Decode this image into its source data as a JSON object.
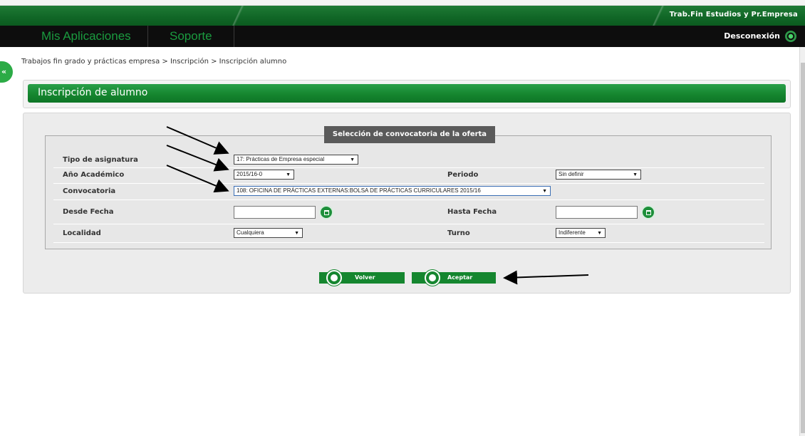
{
  "header": {
    "app_name": "Trab.Fin Estudios y Pr.Empresa",
    "nav": [
      "Mis Aplicaciones",
      "Soporte"
    ],
    "logout_label": "Desconexión"
  },
  "breadcrumb": "Trabajos fin grado y prácticas empresa > Inscripción > Inscripción alumno",
  "page_title": "Inscripción de alumno",
  "form": {
    "legend": "Selección de convocatoria de la oferta",
    "tipo_label": "Tipo de asignatura",
    "tipo_value": "17: Prácticas de Empresa especial",
    "anio_label": "Año Académico",
    "anio_value": "2015/16-0",
    "periodo_label": "Periodo",
    "periodo_value": "Sin definir",
    "convocatoria_label": "Convocatoria",
    "convocatoria_value": "108: OFICINA DE PRÁCTICAS EXTERNAS:BOLSA DE PRÁCTICAS CURRICULARES 2015/16",
    "desde_label": "Desde Fecha",
    "desde_value": "",
    "hasta_label": "Hasta Fecha",
    "hasta_value": "",
    "localidad_label": "Localidad",
    "localidad_value": "Cualquiera",
    "turno_label": "Turno",
    "turno_value": "Indiferente"
  },
  "buttons": {
    "volver": "Volver",
    "aceptar": "Aceptar"
  },
  "colors": {
    "brand_green": "#15862f",
    "nav_green": "#1a9b3f",
    "legend_bg": "#5a5a5a"
  },
  "icons": [
    "calendar-icon",
    "back-icon",
    "check-icon",
    "power-icon",
    "collapse-handle-icon"
  ]
}
